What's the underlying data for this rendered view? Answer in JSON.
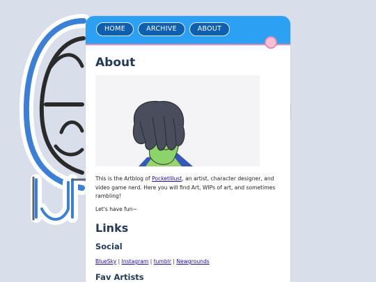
{
  "nav": {
    "home_label": "HOME",
    "archive_label": "ARCHIVE",
    "about_label": "ABOUT"
  },
  "about": {
    "heading": "About",
    "intro_prefix": "This is the Artblog of ",
    "intro_link": "PocketIllust",
    "intro_suffix": ", an artist, character designer, and video game nerd. Here you will find Art, WIPs of art, and sometimes rambling!",
    "closing": "Let's have fun~"
  },
  "links": {
    "heading": "Links",
    "social_heading": "Social",
    "social": [
      "BlueSky",
      "Instagram",
      "tumblr",
      "Newgrounds"
    ],
    "separator": "|",
    "fav_heading": "Fav Artists"
  },
  "colors": {
    "background": "#d9deeb",
    "nav": "#2ca0f2",
    "nav_button": "#0f5fb0",
    "accent_pink": "#e88ab8",
    "heading": "#233a5a"
  }
}
